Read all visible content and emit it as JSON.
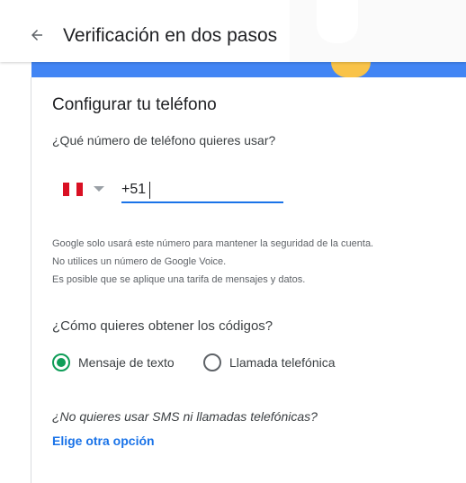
{
  "header": {
    "title": "Verificación en dos pasos",
    "back_icon": "arrow-left-icon"
  },
  "setup": {
    "section_title": "Configurar tu teléfono",
    "question": "¿Qué número de teléfono quieres usar?",
    "country_flag": "peru-flag-icon",
    "phone_value": "+51 ",
    "info_lines": [
      "Google solo usará este número para mantener la seguridad de la cuenta.",
      "No utilices un número de Google Voice.",
      "Es posible que se aplique una tarifa de mensajes y datos."
    ]
  },
  "codes": {
    "question": "¿Cómo quieres obtener los códigos?",
    "options": [
      {
        "label": "Mensaje de texto",
        "selected": true
      },
      {
        "label": "Llamada telefónica",
        "selected": false
      }
    ]
  },
  "alternative": {
    "question": "¿No quieres usar SMS ni llamadas telefónicas?",
    "link": "Elige otra opción"
  },
  "colors": {
    "accent_blue": "#1a73e8",
    "banner_blue": "#4285f4",
    "radio_green": "#0f9d58",
    "flag_red": "#d91023"
  }
}
